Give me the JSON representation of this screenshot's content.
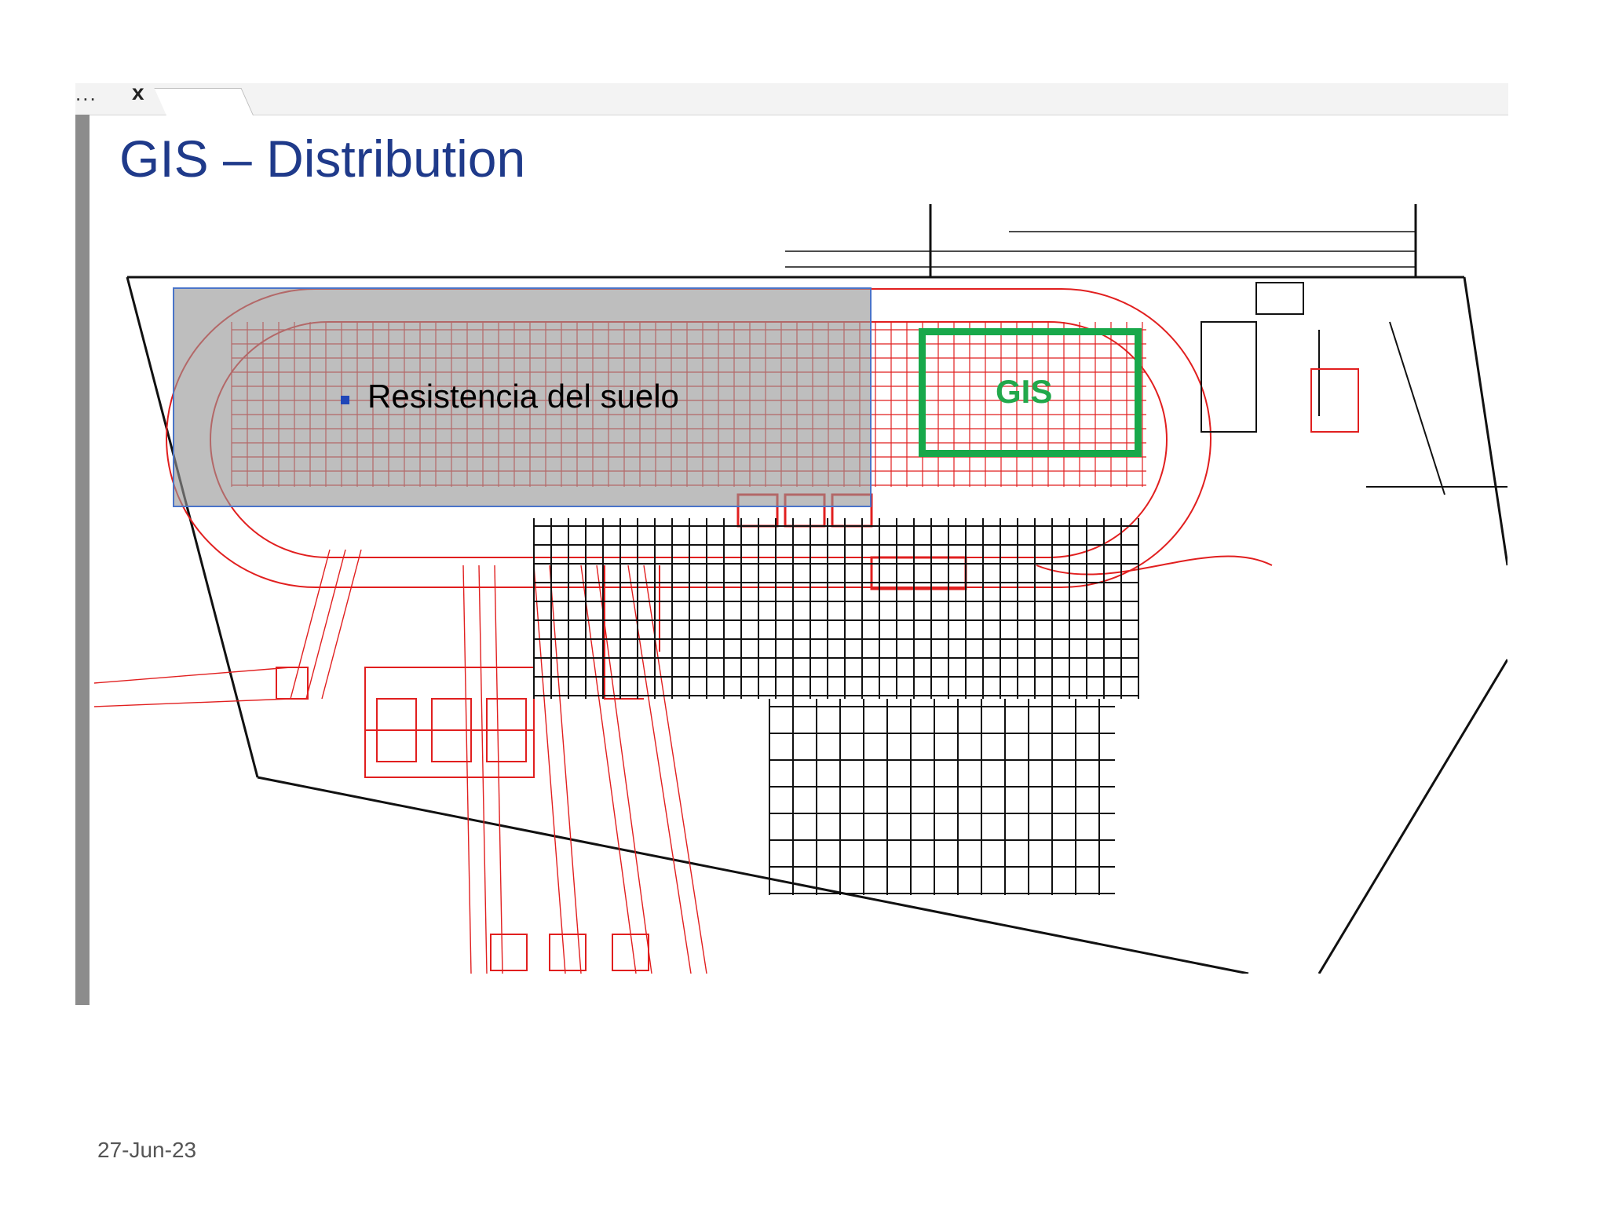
{
  "tab_strip": {
    "menu_glyph": "...",
    "close_glyph": "x"
  },
  "slide": {
    "title": "GIS – Distribution",
    "bullet_text": "Resistencia del suelo",
    "gis_label": "GIS",
    "footer_date": "27-Jun-23"
  },
  "colors": {
    "title": "#1f3a8a",
    "cad_red": "#e11f1f",
    "cad_black": "#111111",
    "gis_green": "#18a84a",
    "overlay_gray": "#969696",
    "overlay_border": "#4a74c9"
  }
}
